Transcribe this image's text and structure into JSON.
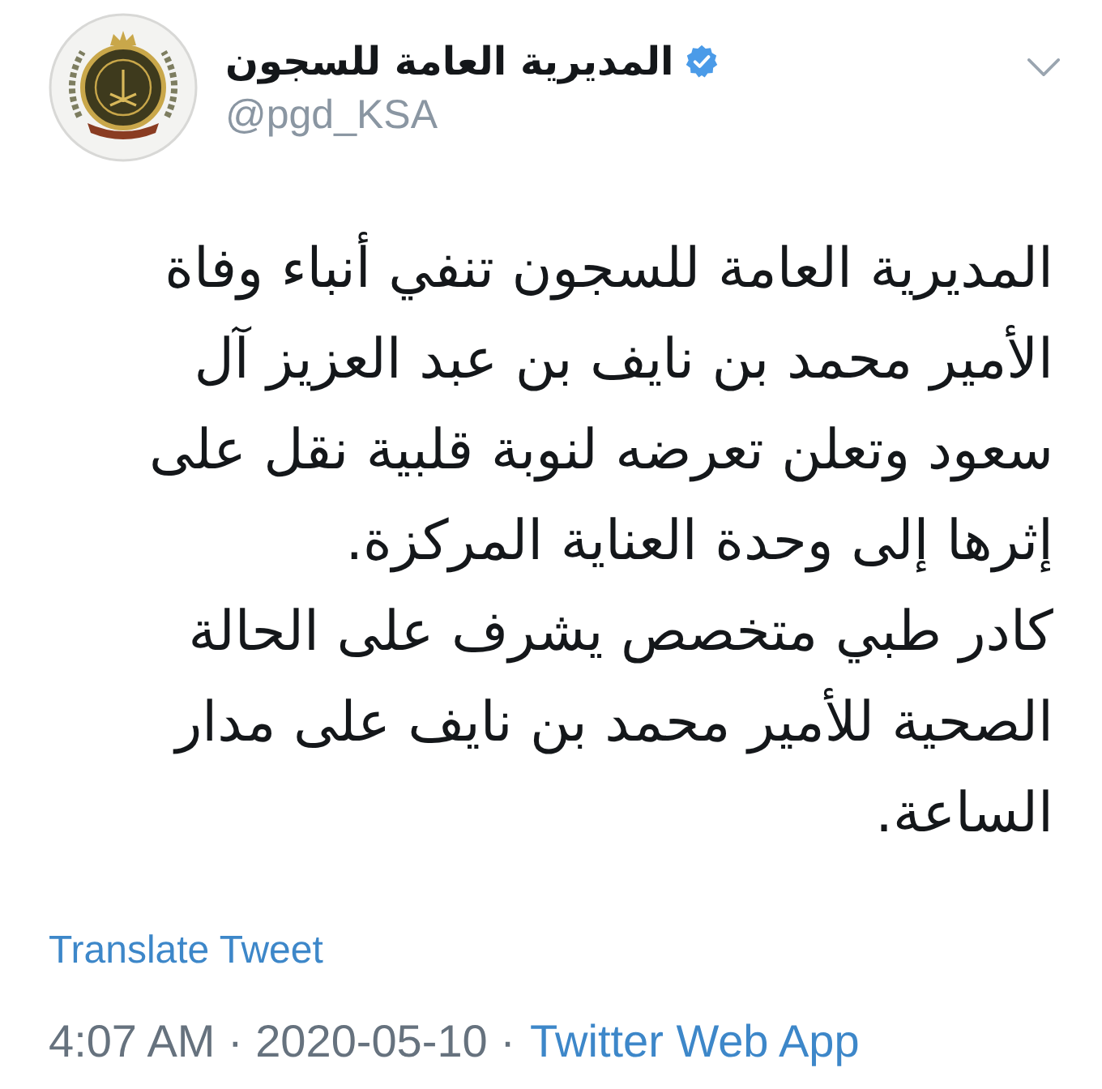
{
  "author": {
    "name": "المديرية العامة للسجون",
    "verified": true,
    "handle": "@pgd_KSA"
  },
  "tweet": {
    "text": "المديرية العامة للسجون تنفي أنباء وفاة\nالأمير محمد بن نايف بن عبد العزيز آل\nسعود وتعلن تعرضه لنوبة قلبية نقل على\nإثرها إلى وحدة العناية المركزة.\nكادر طبي متخصص يشرف على الحالة\nالصحية للأمير محمد بن نايف على مدار\nالساعة.",
    "translate_link": "Translate Tweet"
  },
  "meta": {
    "timestamp": "4:07 AM · 2020-05-10 ·",
    "source": "Twitter Web App"
  }
}
